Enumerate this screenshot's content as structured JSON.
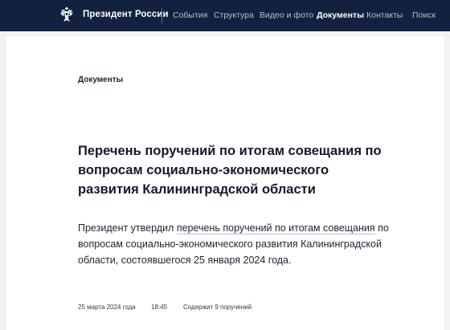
{
  "header": {
    "brand": "Президент России",
    "logo_icon": "double-headed-eagle-icon",
    "nav": [
      {
        "label": "События",
        "active": false
      },
      {
        "label": "Структура",
        "active": false
      },
      {
        "label": "Видео и фото",
        "active": false
      },
      {
        "label": "Документы",
        "active": true
      },
      {
        "label": "Контакты",
        "active": false
      },
      {
        "label": "Поиск",
        "active": false
      }
    ]
  },
  "colors": {
    "header_bg": "#11213f",
    "page_bg": "#f3f3f1",
    "text": "#1b2336"
  },
  "article": {
    "section": "Документы",
    "title": "Перечень поручений по итогам совещания по вопросам социально-экономического развития Калининградской области",
    "lead": {
      "before": "Президент утвердил ",
      "link": "перечень поручений по итогам совещания",
      "after": " по вопросам социально-экономического развития Калининградской области, состоявшегося 25 января 2024 года."
    },
    "meta": {
      "date": "25 марта 2024 года",
      "time": "18:45",
      "count": "Содержит 9 поручений"
    }
  }
}
